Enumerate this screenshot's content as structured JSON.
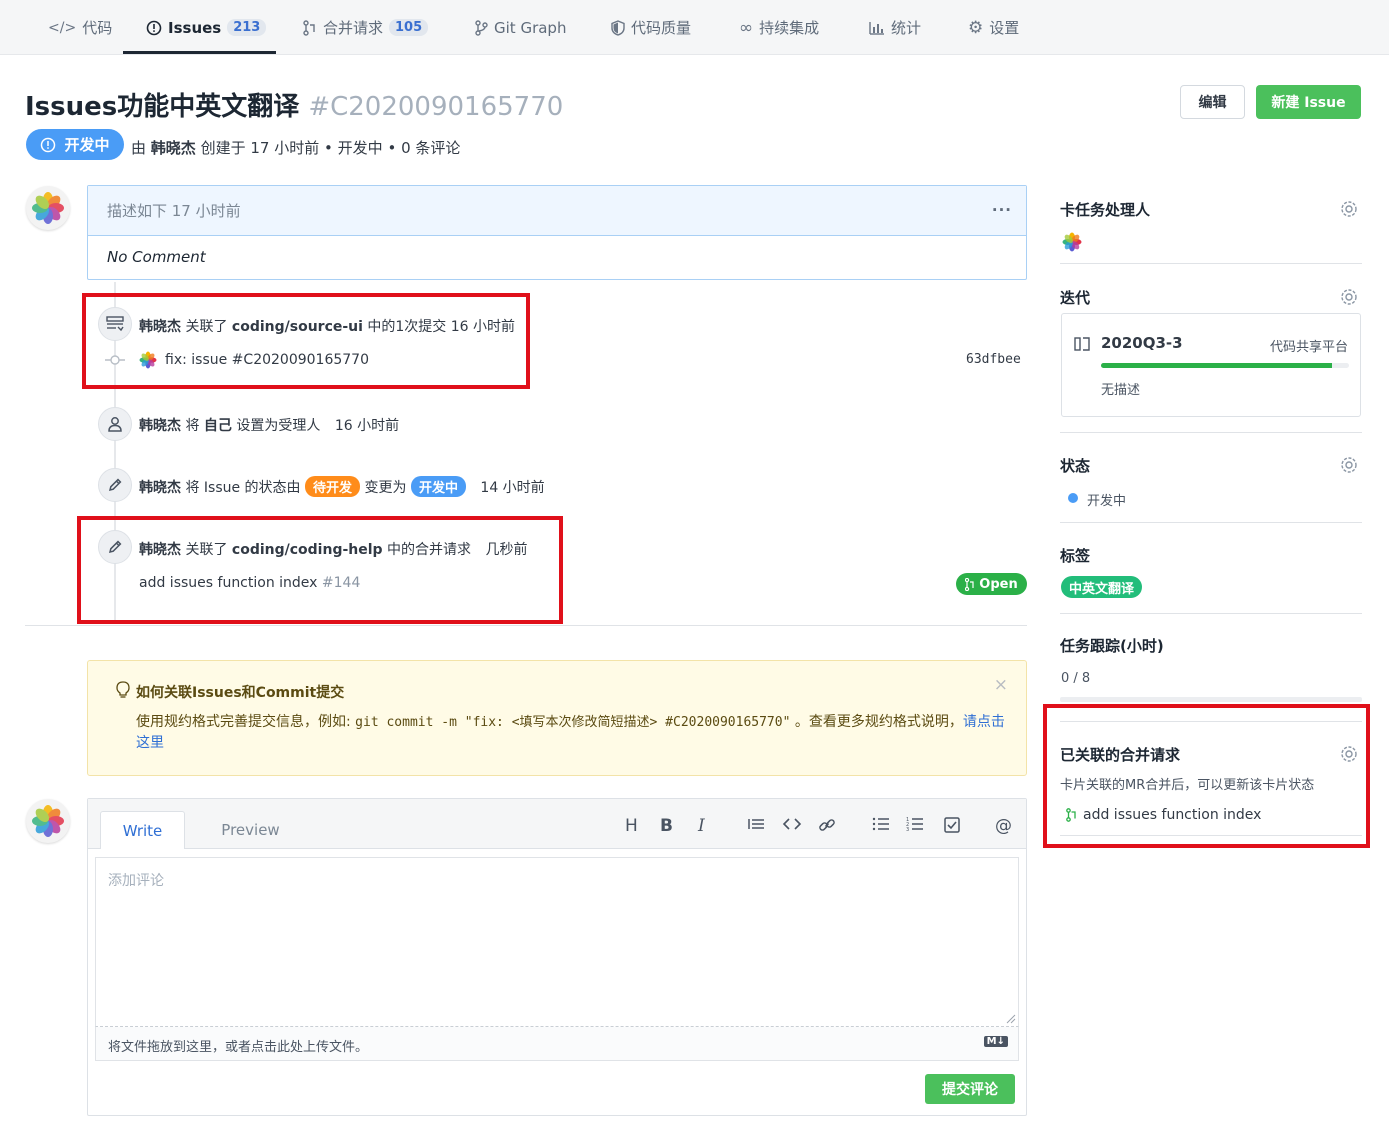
{
  "tabs": [
    {
      "icon": "code-icon",
      "label": "代码",
      "count": ""
    },
    {
      "icon": "issue-icon",
      "label": "Issues",
      "count": "213"
    },
    {
      "icon": "merge-request-icon",
      "label": "合并请求",
      "count": "105"
    },
    {
      "icon": "git-graph-icon",
      "label": "Git Graph",
      "count": ""
    },
    {
      "icon": "shield-icon",
      "label": "代码质量",
      "count": ""
    },
    {
      "icon": "infinity-icon",
      "label": "持续集成",
      "count": ""
    },
    {
      "icon": "bar-chart-icon",
      "label": "统计",
      "count": ""
    },
    {
      "icon": "gear-icon",
      "label": "设置",
      "count": ""
    }
  ],
  "issue": {
    "title": "Issues功能中英文翻译",
    "number": "#C2020090165770",
    "status": "开发中",
    "meta_by": "由",
    "author": "韩晓杰",
    "meta_created": "创建于 17 小时前",
    "meta_state": "开发中",
    "meta_comments": "0 条评论"
  },
  "header_buttons": {
    "edit": "编辑",
    "new": "新建 Issue"
  },
  "description": {
    "header": "描述如下 17 小时前",
    "body": "No Comment",
    "more": "···"
  },
  "timeline": {
    "e1": {
      "user": "韩晓杰",
      "action": "关联了",
      "repo": "coding/source-ui",
      "rest": "中的1次提交 16 小时前",
      "commit_msg": "fix: issue #C2020090165770",
      "commit_hash": "63dfbee"
    },
    "e2": {
      "user": "韩晓杰",
      "action": "将",
      "target": "自己",
      "rest": "设置为受理人",
      "time": "16 小时前"
    },
    "e3": {
      "user": "韩晓杰",
      "action": "将 Issue 的状态由",
      "from": "待开发",
      "mid": "变更为",
      "to": "开发中",
      "time": "14 小时前"
    },
    "e4": {
      "user": "韩晓杰",
      "action": "关联了",
      "repo": "coding/coding-help",
      "rest": "中的合并请求",
      "time": "几秒前",
      "mr_title": "add issues function index",
      "mr_num": "#144",
      "mr_status": "Open"
    }
  },
  "tip": {
    "title": "如何关联Issues和Commit提交",
    "body_prefix": "使用规约格式完善提交信息，例如: ",
    "code": "git commit -m \"fix: <填写本次修改简短描述> #C2020090165770\"",
    "body_suffix": " 。查看更多规约格式说明，",
    "link": "请点击这里",
    "close": "×"
  },
  "editor": {
    "tab_write": "Write",
    "tab_preview": "Preview",
    "tools": [
      "H",
      "B",
      "I",
      "quote",
      "code",
      "link",
      "ul",
      "ol",
      "task",
      "@"
    ],
    "placeholder": "添加评论",
    "footer": "将文件拖放到这里，或者点击此处上传文件。",
    "md_badge": "M↓",
    "submit": "提交评论"
  },
  "sidebar": {
    "assignee_title": "卡任务处理人",
    "iteration_title": "迭代",
    "iteration_name": "2020Q3-3",
    "iteration_project": "代码共享平台",
    "iteration_progress": 0.93,
    "iteration_desc": "无描述",
    "status_title": "状态",
    "status_value": "开发中",
    "labels_title": "标签",
    "label": "中英文翻译",
    "tracking_title": "任务跟踪(小时)",
    "tracking_value": "0 / 8",
    "linked_mr_title": "已关联的合并请求",
    "linked_mr_desc": "卡片关联的MR合并后，可以更新该卡片状态",
    "linked_mr_item": "add issues function index"
  },
  "colors": {
    "accent": "#4a9cf6",
    "green": "#4bc05c",
    "highlight": "#e0101a",
    "todo": "#ff8c1a"
  }
}
